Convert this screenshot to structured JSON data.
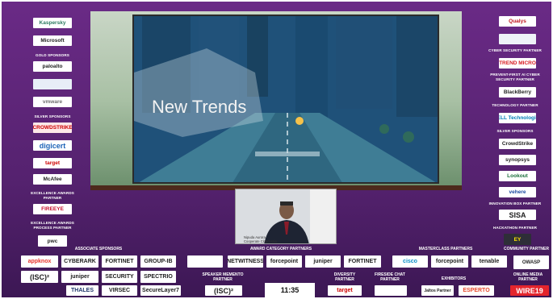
{
  "left_column": {
    "logos_top": [
      "Kaspersky",
      "Microsoft"
    ],
    "gold_caption": "GOLD SPONSORS",
    "gold_logos": [
      "paloalto",
      "",
      "vmware"
    ],
    "silver_caption": "SILVER SPONSORS",
    "silver_logos": [
      "CROWDSTRIKE",
      "digicert",
      "target",
      "McAfee"
    ],
    "excellence_caption": "EXCELLENCE AWARDS PARTNER",
    "excellence_logo": "FIREEYE",
    "process_caption": "EXCELLENCE AWARDS PROCESS PARTNER",
    "process_logo": "pwc"
  },
  "right_column": {
    "top_logo": "Qualys",
    "cyber_logo": "",
    "cyber_caption": "CYBER SECURITY PARTNER",
    "ai_logo": "TREND MICRO",
    "ai_caption": "PREVENT-FIRST AI CYBER SECURITY PARTNER",
    "tech_logo": "BlackBerry",
    "tech_caption": "TECHNOLOGY PARTNER",
    "silver_logo_top": "DELL Technologies",
    "silver_caption": "SILVER SPONSORS",
    "silver_logos": [
      "CrowdStrike",
      "synopsys",
      "Lookout",
      "vehere"
    ],
    "innovation_caption": "INNOVATION BOX PARTNER",
    "innovation_logo": "SISA",
    "hackathon_caption": "HACKATHON PARTNER",
    "hackathon_logo": "EY"
  },
  "screen": {
    "title": "New Trends"
  },
  "speaker": {
    "name": "Nipuda Aurora",
    "role": "Cooperate Cloud Asia"
  },
  "bottom": {
    "associate_caption": "ASSOCIATE SPONSORS",
    "associate_row1": [
      "appknox",
      "CYBERARK",
      "FORTINET",
      "GROUP-IB"
    ],
    "associate_row2": [
      "(ISC)²",
      "juniper",
      "SECURITY",
      "SPECTRIO"
    ],
    "associate_row3": [
      "THALES",
      "VIRSEC",
      "SecureLayer7"
    ],
    "award_caption": "AWARD CATEGORY PARTNERS",
    "award_logos": [
      "",
      "NETWITNESS",
      "forcepoint",
      "juniper",
      "FORTINET"
    ],
    "memento_caption": "SPEAKER MEMENTO PARTNER",
    "memento_logo": "(ISC)²",
    "clock": "11:35",
    "diversity_caption": "DIVERSITY PARTNER",
    "diversity_logo": "target",
    "fireside_caption": "FIRESIDE CHAT PARTNER",
    "fireside_logo": "",
    "masterclass_caption": "MASTERCLASS PARTNERS",
    "masterclass_logos": [
      "cisco",
      "forcepoint",
      "tenable"
    ],
    "exhibitors_caption": "EXHIBITORS",
    "exhibitors_logos": [
      "Jaltos Partner",
      "ESPERTO"
    ],
    "community_caption": "COMMUNITY PARTNER",
    "community_logo": "OWASP",
    "media_caption": "ONLINE MEDIA PARTNER",
    "media_logo": "WIRE19"
  }
}
